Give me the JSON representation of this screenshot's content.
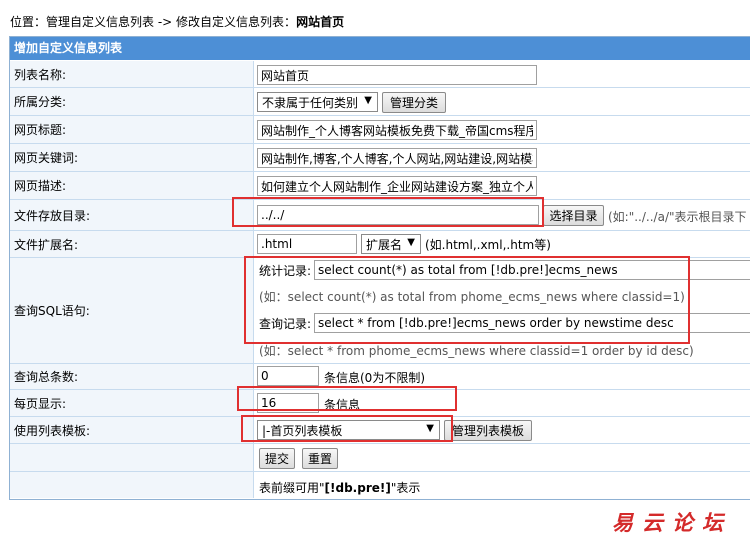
{
  "breadcrumb": {
    "prefix": "位置：",
    "link": "管理自定义信息列表",
    "sep": " -> ",
    "middle": "修改自定义信息列表：",
    "current": "网站首页"
  },
  "panel_title": "增加自定义信息列表",
  "fields": {
    "list_name": {
      "label": "列表名称:",
      "value": "网站首页"
    },
    "category": {
      "label": "所属分类:",
      "selected": "不隶属于任何类别",
      "manage_btn": "管理分类"
    },
    "page_title": {
      "label": "网页标题:",
      "value": "网站制作_个人博客网站模板免费下载_帝国cms程序"
    },
    "keywords": {
      "label": "网页关键词:",
      "value": "网站制作,博客,个人博客,个人网站,网站建设,网站模板"
    },
    "description": {
      "label": "网页描述:",
      "value": "如何建立个人网站制作_企业网站建设方案_独立个人"
    },
    "directory": {
      "label": "文件存放目录:",
      "value": "../../",
      "btn": "选择目录",
      "hint": "(如:\"../../a/\"表示根目录下"
    },
    "extension": {
      "label": "文件扩展名:",
      "value": ".html",
      "selected": "扩展名",
      "hint": "(如.html,.xml,.htm等)"
    },
    "sql": {
      "label": "查询SQL语句:",
      "count_label": "统计记录:",
      "count_value": "select count(*) as total from [!db.pre!]ecms_news",
      "count_hint": "(如：select count(*) as total from phome_ecms_news where classid=1)",
      "query_label": "查询记录:",
      "query_value": "select * from [!db.pre!]ecms_news order by newstime desc",
      "query_hint": "(如：select * from phome_ecms_news where classid=1 order by id desc)"
    },
    "total": {
      "label": "查询总条数:",
      "value": "0",
      "suffix": "条信息(0为不限制)"
    },
    "per_page": {
      "label": "每页显示:",
      "value": "16",
      "suffix": "条信息"
    },
    "template": {
      "label": "使用列表模板:",
      "selected": "|-首页列表模板",
      "manage_btn": "管理列表模板"
    }
  },
  "actions": {
    "submit": "提交",
    "reset": "重置"
  },
  "footer_note": {
    "before": "表前缀可用\"",
    "code": "[!db.pre!]",
    "after": "\"表示"
  },
  "watermark": "易云论坛",
  "accent_colors": {
    "header": "#4d8fd6",
    "label_bg": "#f1f6fb",
    "highlight": "#e03030"
  }
}
